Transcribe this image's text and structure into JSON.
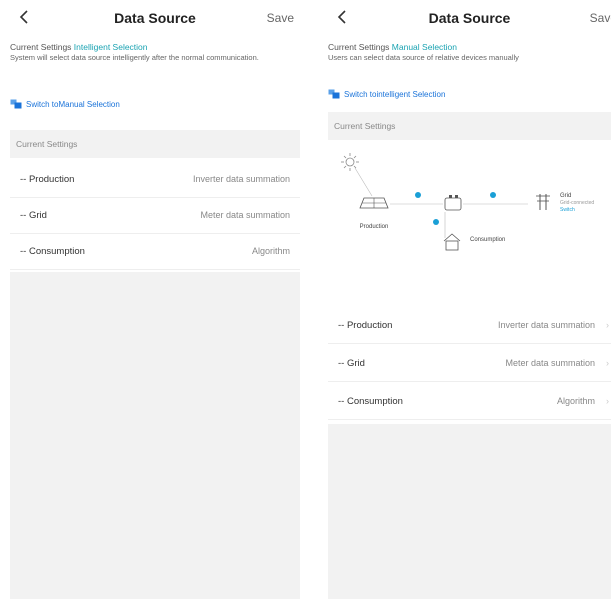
{
  "left": {
    "title": "Data Source",
    "save_label": "Save",
    "settings_prefix": "Current Settings",
    "settings_mode": "Intelligent Selection",
    "description": "System will select data source intelligently after the normal communication.",
    "switch_link": "Switch toManual Selection",
    "section_header": "Current Settings",
    "rows": [
      {
        "label": "-- Production",
        "value": "Inverter data summation"
      },
      {
        "label": "-- Grid",
        "value": "Meter data summation"
      },
      {
        "label": "-- Consumption",
        "value": "Algorithm"
      }
    ]
  },
  "right": {
    "title": "Data Source",
    "save_label": "Save",
    "settings_prefix": "Current Settings",
    "settings_mode": "Manual Selection",
    "description": "Users can select data source of relative devices manually",
    "switch_link": "Switch tointelligent Selection",
    "section_header": "Current Settings",
    "diagram": {
      "production_label": "Production",
      "consumption_label": "Consumption",
      "grid_label": "Grid",
      "grid_status": "Grid-connected",
      "grid_switch": "Switch"
    },
    "rows": [
      {
        "label": "-- Production",
        "value": "Inverter data summation"
      },
      {
        "label": "-- Grid",
        "value": "Meter data summation"
      },
      {
        "label": "-- Consumption",
        "value": "Algorithm"
      }
    ]
  },
  "colors": {
    "accent": "#1aa3b2",
    "link": "#1a73d9",
    "diagram_node": "#1a9fd6",
    "section_bg": "#f2f2f2"
  },
  "icons": [
    "back-arrow-icon",
    "switch-icon",
    "sun-icon",
    "solar-panel-icon",
    "battery-icon",
    "home-icon",
    "grid-tower-icon",
    "chevron-right-icon"
  ]
}
